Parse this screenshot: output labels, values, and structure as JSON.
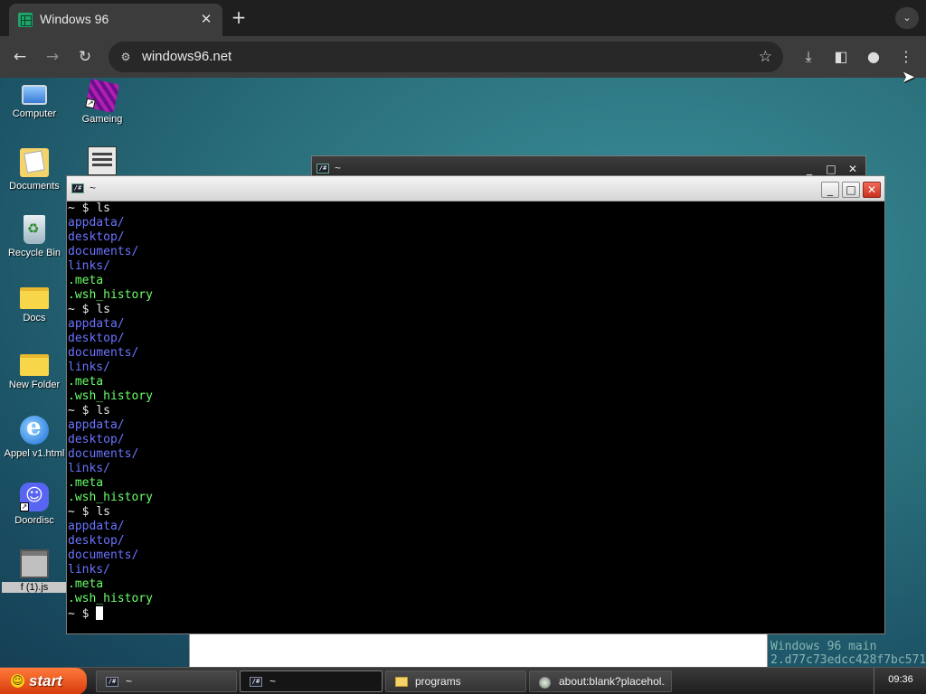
{
  "browser": {
    "tab_title": "Windows 96",
    "tab_close": "✕",
    "new_tab": "+",
    "tab_search": "⌄",
    "nav": {
      "back": "←",
      "forward": "→",
      "reload": "↻"
    },
    "url": "windows96.net",
    "site_info": "⚙",
    "bookmark": "☆",
    "download": "⤓",
    "sidepanel": "◧",
    "profile": "●",
    "menu": "⋮"
  },
  "desktop": {
    "icons": [
      {
        "label": "Computer",
        "icon": "computer-icon"
      },
      {
        "label": "Gameing",
        "icon": "gaming-icon"
      },
      {
        "label": "Documents",
        "icon": "documents-icon"
      },
      {
        "label": "Recycle Bin",
        "icon": "recycle-bin-icon"
      },
      {
        "label": "Docs",
        "icon": "folder-icon"
      },
      {
        "label": "New Folder",
        "icon": "folder-icon"
      },
      {
        "label": "Appel v1.html",
        "icon": "internet-explorer-icon"
      },
      {
        "label": "Doordisc",
        "icon": "discord-icon"
      },
      {
        "label": "f (1).js",
        "icon": "window-file-icon"
      }
    ]
  },
  "windows": {
    "back_terminal": {
      "title": "~",
      "min": "_",
      "max": "□",
      "close": "✕"
    },
    "front_terminal": {
      "title": "~",
      "min": "_",
      "max": "□",
      "close": "✕",
      "icon_text": "/#"
    }
  },
  "terminal": {
    "prompt": "~ $ ",
    "command": "ls",
    "dirs": [
      "appdata/",
      "desktop/",
      "documents/",
      "links/"
    ],
    "files": [
      ".meta",
      ".wsh_history"
    ]
  },
  "watermark": {
    "line1": "Windows 96 main",
    "line2": "2.d77c73edcc428f7bc571"
  },
  "taskbar": {
    "start_label": "start",
    "tasks": [
      {
        "label": "~",
        "icon": "terminal-icon"
      },
      {
        "label": "~",
        "icon": "terminal-icon",
        "active": true
      },
      {
        "label": "programs",
        "icon": "folder-icon"
      },
      {
        "label": "about:blank?placehol...",
        "icon": "web-icon"
      }
    ],
    "clock": "09:36"
  },
  "colors": {
    "terminal_dir": "#6b74ff",
    "terminal_file": "#6bff6b",
    "start_button": "#e0521a",
    "close_button": "#d8402c"
  }
}
